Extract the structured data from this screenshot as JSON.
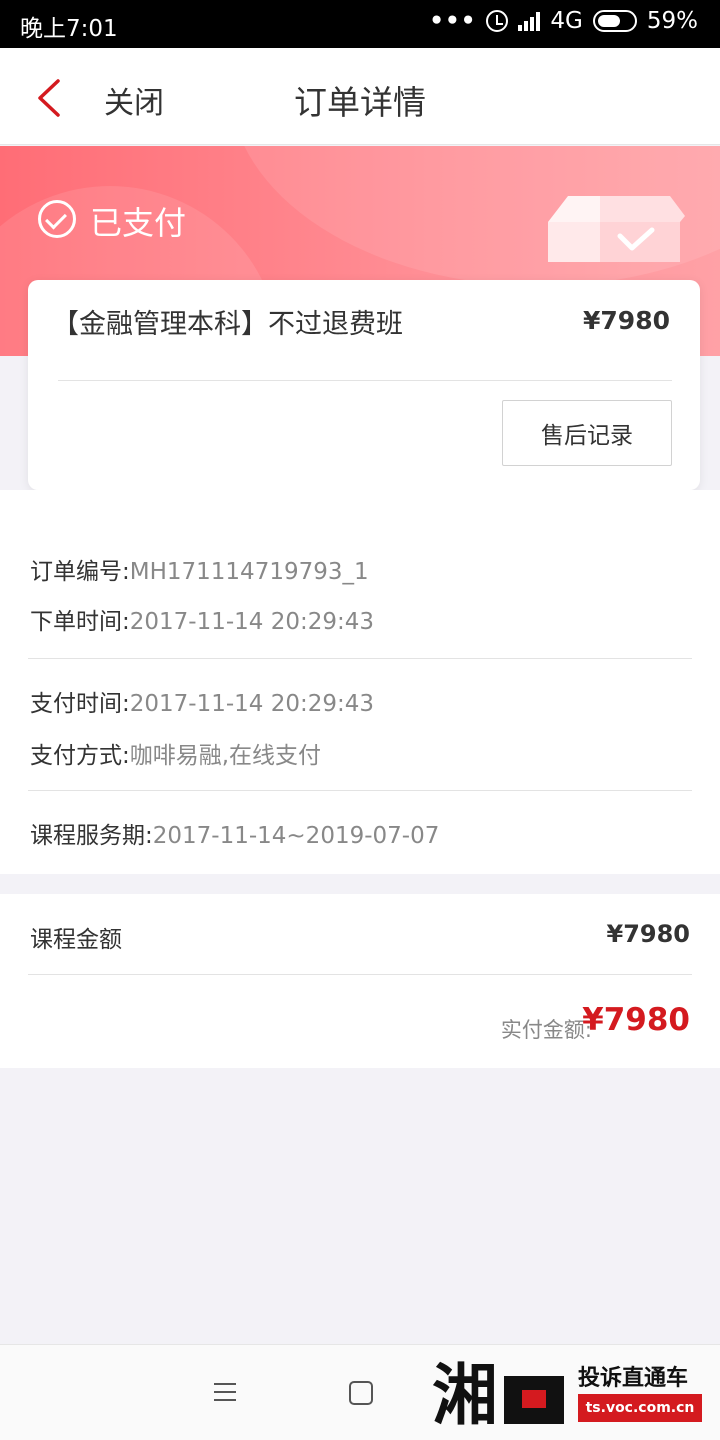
{
  "status_bar": {
    "time": "晚上7:01",
    "dots": "•••",
    "network": "4G",
    "battery": "59%"
  },
  "nav": {
    "back_icon": "chevron-left-icon",
    "close_label": "关闭",
    "title": "订单详情"
  },
  "header": {
    "status_icon": "check-circle-icon",
    "status_label": "已支付",
    "illustration": "box-check-icon",
    "colors": {
      "gradient_start": "#ff6d76",
      "gradient_end": "#ffa1a6"
    }
  },
  "product": {
    "name": "【金融管理本科】不过退费班",
    "price": "¥7980",
    "after_sale_button": "售后记录"
  },
  "order_info": {
    "order_no_key": "订单编号:",
    "order_no_val": "MH171114719793_1",
    "order_time_key": "下单时间:",
    "order_time_val": "2017-11-14 20:29:43",
    "pay_time_key": "支付时间:",
    "pay_time_val": "2017-11-14 20:29:43",
    "pay_method_key": "支付方式:",
    "pay_method_val": "咖啡易融,在线支付",
    "service_period_key": "课程服务期:",
    "service_period_val": "2017-11-14~2019-07-07"
  },
  "amount": {
    "course_amount_label": "课程金额",
    "course_amount_value": "¥7980",
    "paid_label": "实付金额:",
    "paid_value": "¥7980",
    "accent_color": "#d41a1f"
  },
  "bottom_nav": {
    "menu_icon": "menu-icon",
    "home_icon": "square-home-icon"
  },
  "watermark": {
    "logo_text": "湘问",
    "title": "投诉直通车",
    "url": "ts.voc.com.cn"
  }
}
